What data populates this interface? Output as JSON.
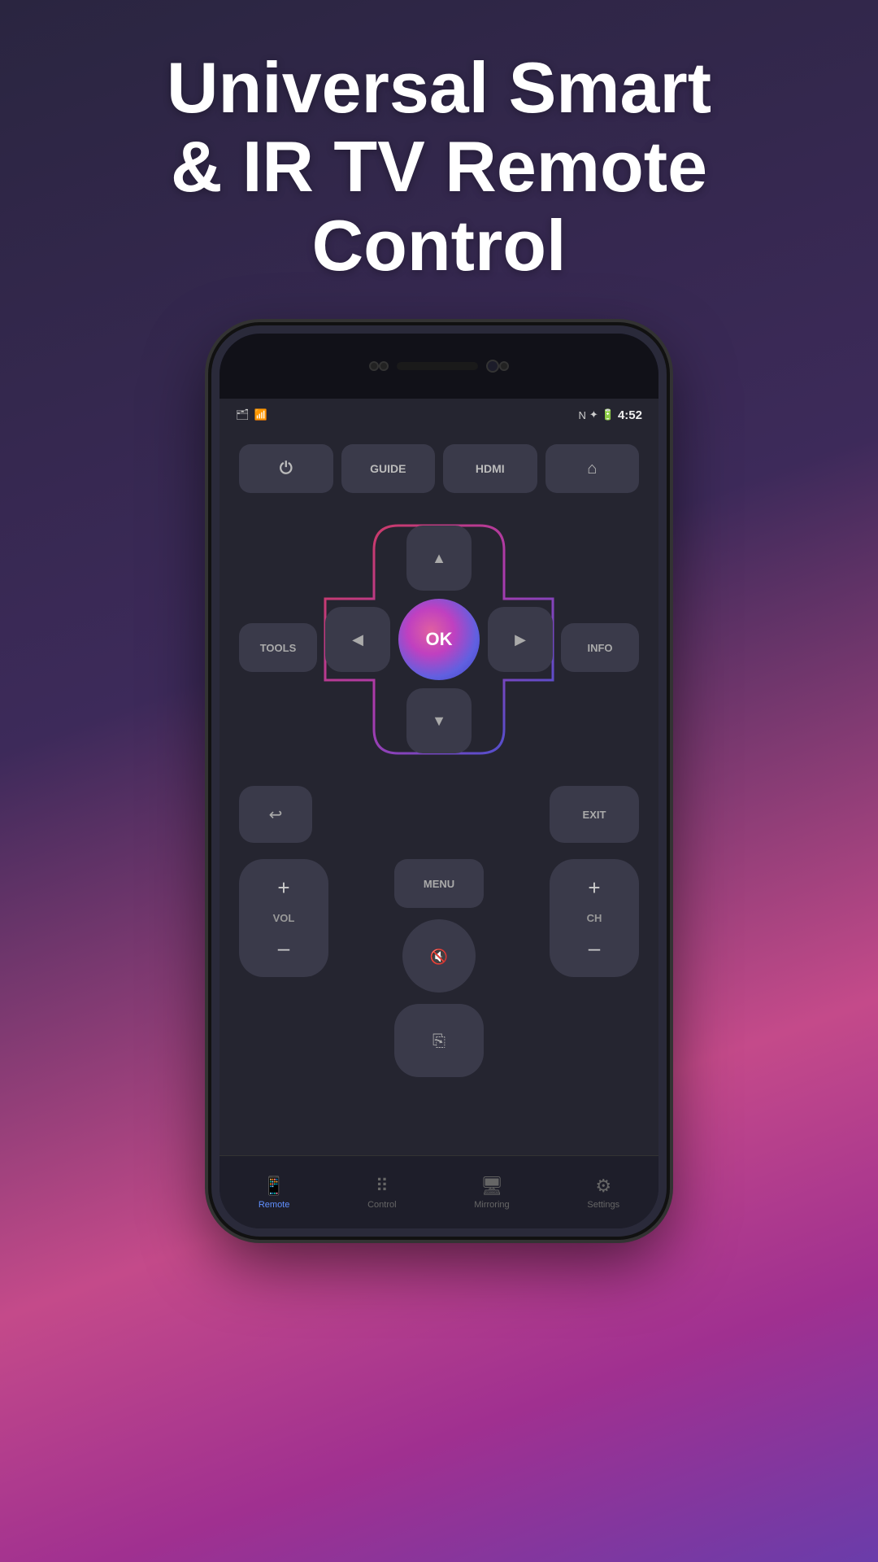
{
  "title": {
    "line1": "Universal Smart",
    "line2": "& IR TV Remote Control"
  },
  "status_bar": {
    "time": "4:52",
    "icons": [
      "nfc",
      "bluetooth",
      "battery"
    ]
  },
  "remote": {
    "top_buttons": [
      {
        "label": "",
        "type": "power",
        "id": "power"
      },
      {
        "label": "GUIDE",
        "id": "guide"
      },
      {
        "label": "HDMI",
        "id": "hdmi"
      },
      {
        "label": "",
        "type": "home",
        "id": "home"
      }
    ],
    "side_labels": {
      "left": "TOOLS",
      "right": "INFO"
    },
    "dpad": {
      "up": "▲",
      "down": "▼",
      "left": "◀",
      "right": "▶",
      "ok": "OK"
    },
    "back_exit": {
      "back_label": "↩",
      "exit_label": "EXIT"
    },
    "menu_label": "MENU",
    "vol": {
      "plus": "+",
      "label": "VOL",
      "minus": "–"
    },
    "mute_label": "🔇",
    "ch": {
      "plus": "+",
      "label": "CH",
      "minus": "–"
    },
    "input_label": "⎘"
  },
  "bottom_nav": [
    {
      "id": "remote",
      "label": "Remote",
      "active": true,
      "icon": "📱"
    },
    {
      "id": "control",
      "label": "Control",
      "active": false,
      "icon": "⠿"
    },
    {
      "id": "mirroring",
      "label": "Mirroring",
      "active": false,
      "icon": "🖥"
    },
    {
      "id": "settings",
      "label": "Settings",
      "active": false,
      "icon": "⚙"
    }
  ]
}
